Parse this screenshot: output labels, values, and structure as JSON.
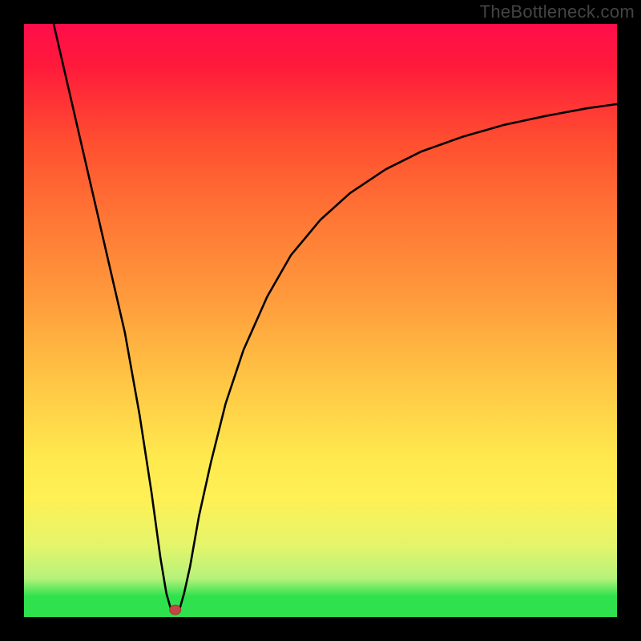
{
  "watermark": "TheBottleneck.com",
  "colors": {
    "stroke": "#000000",
    "dot_fill": "#c44545",
    "dot_stroke": "#a33737",
    "green": "#2fe24d",
    "lightgreen": "#b6f27b",
    "yellowgreen": "#e4f56b",
    "yellow": "#fff055",
    "yellow2": "#ffe94e",
    "orange_light": "#ffc544",
    "orange": "#ff9a3c",
    "orange_dark": "#ff7735",
    "red_orange": "#ff4f30",
    "red": "#ff1a3b",
    "red_top": "#ff0d4a"
  },
  "chart_data": {
    "type": "line",
    "title": "",
    "xlabel": "",
    "ylabel": "",
    "xlim": [
      0,
      100
    ],
    "ylim": [
      0,
      100
    ],
    "series": [
      {
        "name": "curve",
        "points": [
          [
            5,
            100
          ],
          [
            8,
            87
          ],
          [
            11,
            74
          ],
          [
            14,
            61
          ],
          [
            17,
            48
          ],
          [
            19.5,
            34
          ],
          [
            21.5,
            21
          ],
          [
            23,
            10
          ],
          [
            24,
            4
          ],
          [
            24.8,
            1.2
          ],
          [
            26.2,
            1.2
          ],
          [
            27,
            4
          ],
          [
            28,
            8.5
          ],
          [
            29.5,
            17
          ],
          [
            31.5,
            26
          ],
          [
            34,
            36
          ],
          [
            37,
            45
          ],
          [
            41,
            54
          ],
          [
            45,
            61
          ],
          [
            50,
            67
          ],
          [
            55,
            71.5
          ],
          [
            61,
            75.5
          ],
          [
            67,
            78.5
          ],
          [
            74,
            81
          ],
          [
            81,
            83
          ],
          [
            88,
            84.5
          ],
          [
            95,
            85.8
          ],
          [
            100,
            86.5
          ]
        ]
      }
    ],
    "marker": {
      "x": 25.5,
      "y": 1.2
    },
    "gradient_stops": [
      {
        "offset": 0,
        "key": "red_top"
      },
      {
        "offset": 0.07,
        "key": "red"
      },
      {
        "offset": 0.2,
        "key": "red_orange"
      },
      {
        "offset": 0.33,
        "key": "orange_dark"
      },
      {
        "offset": 0.46,
        "key": "orange"
      },
      {
        "offset": 0.6,
        "key": "orange_light"
      },
      {
        "offset": 0.73,
        "key": "yellow2"
      },
      {
        "offset": 0.8,
        "key": "yellow"
      },
      {
        "offset": 0.88,
        "key": "yellowgreen"
      },
      {
        "offset": 0.935,
        "key": "lightgreen"
      },
      {
        "offset": 0.965,
        "key": "green"
      },
      {
        "offset": 1.0,
        "key": "green"
      }
    ]
  }
}
